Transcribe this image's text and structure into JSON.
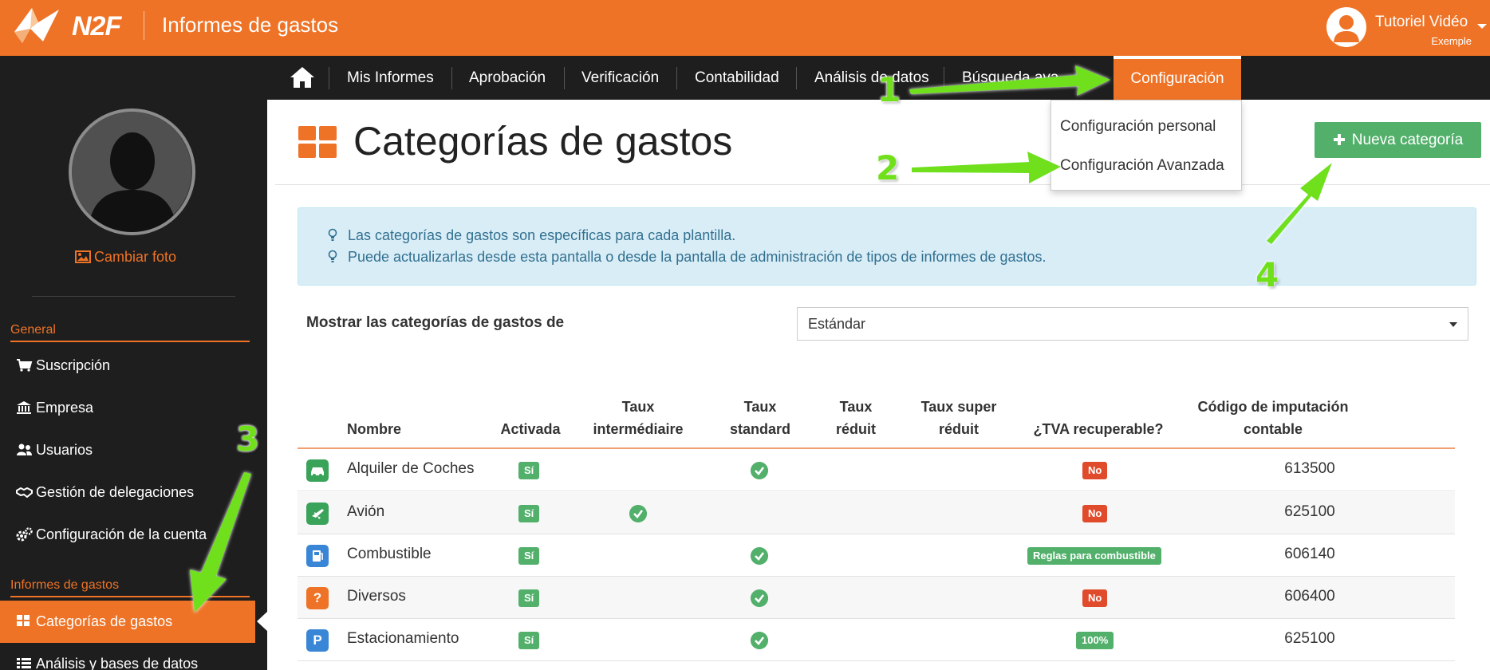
{
  "header": {
    "brand": "N2F",
    "app_title": "Informes de gastos",
    "user_name": "Tutoriel Vidéo",
    "user_company": "Exemple"
  },
  "nav": {
    "items": [
      "Mis Informes",
      "Aprobación",
      "Verificación",
      "Contabilidad",
      "Análisis de datos",
      "Búsqueda ava"
    ],
    "active": "Configuración",
    "dropdown": [
      "Configuración personal",
      "Configuración Avanzada"
    ]
  },
  "sidebar": {
    "change_photo": "Cambiar foto",
    "sections": [
      {
        "title": "General",
        "items": [
          "Suscripción",
          "Empresa",
          "Usuarios",
          "Gestión de delegaciones",
          "Configuración de la cuenta"
        ]
      },
      {
        "title": "Informes de gastos",
        "items": [
          "Categorías de gastos",
          "Análisis y bases de datos"
        ]
      }
    ],
    "active_item": "Categorías de gastos"
  },
  "page": {
    "title": "Categorías de gastos",
    "new_button": "Nueva categoría",
    "info": [
      "Las categorías de gastos son específicas para cada plantilla.",
      "Puede actualizarlas desde esta pantalla o desde la pantalla de administración de tipos de informes de gastos."
    ],
    "filter_label": "Mostrar las categorías de gastos de",
    "filter_value": "Estándar"
  },
  "table": {
    "headers": {
      "nombre": "Nombre",
      "activada": "Activada",
      "inter_1": "Taux",
      "inter_2": "intermédiaire",
      "std_1": "Taux",
      "std_2": "standard",
      "red_1": "Taux",
      "red_2": "réduit",
      "super_1": "Taux super",
      "super_2": "réduit",
      "tva": "¿TVA recuperable?",
      "code_1": "Código de imputación",
      "code_2": "contable"
    },
    "rows": [
      {
        "name": "Alquiler de Coches",
        "active": "Sí",
        "tva": "No",
        "code": "613500",
        "icon": "car-icon",
        "color": "#3aa35a"
      },
      {
        "name": "Avión",
        "active": "Sí",
        "tva": "No",
        "code": "625100",
        "icon": "plane-icon",
        "color": "#3aa35a"
      },
      {
        "name": "Combustible",
        "active": "Sí",
        "tva": "Reglas para combustible",
        "code": "606140",
        "icon": "fuel-icon",
        "color": "#3a86d6"
      },
      {
        "name": "Diversos",
        "active": "Sí",
        "tva": "No",
        "code": "606400",
        "icon": "question-icon",
        "color": "#ee7326",
        "glyph": "?"
      },
      {
        "name": "Estacionamiento",
        "active": "Sí",
        "tva": "100%",
        "code": "625100",
        "icon": "parking-icon",
        "color": "#3a86d6",
        "glyph": "P"
      }
    ]
  },
  "annotations": [
    "1",
    "2",
    "3",
    "4"
  ],
  "colors": {
    "brand": "#ee7326",
    "success": "#52b06b",
    "danger": "#e04b2b",
    "annotation": "#6fe01a"
  }
}
